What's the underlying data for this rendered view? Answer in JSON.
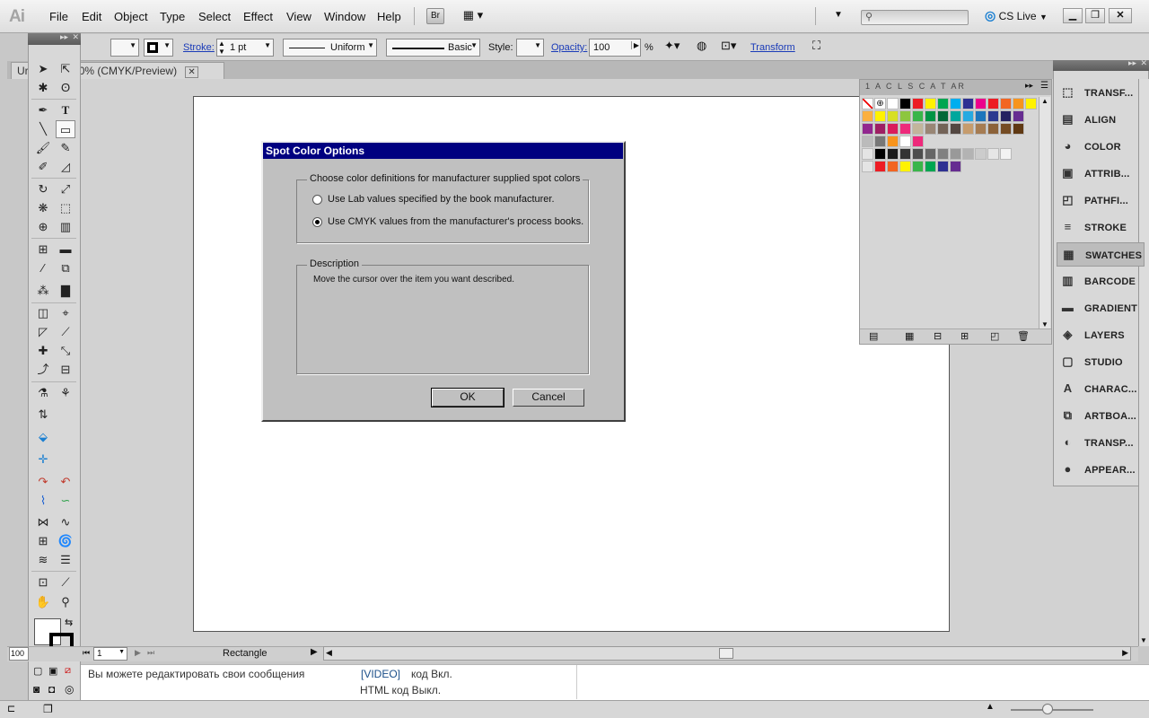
{
  "menubar": {
    "logo": "Ai",
    "items": [
      "File",
      "Edit",
      "Object",
      "Type",
      "Select",
      "Effect",
      "View",
      "Window",
      "Help"
    ],
    "bridge_label": "Br",
    "cslive_label": "CS Live"
  },
  "controlbar": {
    "stroke_label": "Stroke:",
    "stroke_value": "1 pt",
    "profile_label": "Uniform",
    "brush_label": "Basic",
    "style_label": "Style:",
    "opacity_label": "Opacity:",
    "opacity_value": "100",
    "percent": "%",
    "transform_label": "Transform"
  },
  "document": {
    "tab_label": "Ur... @ 100% (CMYK/Preview)",
    "tab_prefix": "Ur",
    "tab_suffix": "100% (CMYK/Preview)",
    "zoom": "100",
    "artboard_number": "1",
    "status_tool": "Rectangle"
  },
  "dialog": {
    "title": "Spot Color Options",
    "group1_legend": "Choose color definitions for manufacturer supplied spot colors",
    "option_lab": "Use Lab values specified by the book manufacturer.",
    "option_cmyk": "Use CMYK values from the manufacturer's process books.",
    "selected_option": "cmyk",
    "group2_legend": "Description",
    "description_text": "Move the cursor over the item you want described.",
    "ok_label": "OK",
    "cancel_label": "Cancel"
  },
  "right_dock": {
    "items": [
      {
        "label": "TRANSF...",
        "icon": "transform-icon"
      },
      {
        "label": "ALIGN",
        "icon": "align-icon"
      },
      {
        "label": "COLOR",
        "icon": "color-icon"
      },
      {
        "label": "ATTRIB...",
        "icon": "attributes-icon"
      },
      {
        "label": "PATHFI...",
        "icon": "pathfinder-icon"
      },
      {
        "label": "STROKE",
        "icon": "stroke-icon"
      },
      {
        "label": "SWATCHES",
        "icon": "swatches-icon"
      },
      {
        "label": "BARCODE",
        "icon": "barcode-icon"
      },
      {
        "label": "GRADIENT",
        "icon": "gradient-icon"
      },
      {
        "label": "LAYERS",
        "icon": "layers-icon"
      },
      {
        "label": "STUDIO",
        "icon": "studio-icon"
      },
      {
        "label": "CHARAC...",
        "icon": "character-icon"
      },
      {
        "label": "ARTBOA...",
        "icon": "artboards-icon"
      },
      {
        "label": "TRANSP...",
        "icon": "transparency-icon"
      },
      {
        "label": "APPEAR...",
        "icon": "appearance-icon"
      }
    ],
    "active": "SWATCHES"
  },
  "swatches_panel": {
    "tab_letters": "1 A C  L S C A T AR",
    "colors_row1": [
      "#ffffff",
      "#000000",
      "#ed1c24",
      "#fff200",
      "#00a651",
      "#00aeef",
      "#2e3192",
      "#ec008c",
      "#ed1c24",
      "#f26522",
      "#f7941d",
      "#fff200"
    ],
    "colors_row2": [
      "#fbb040",
      "#fff200",
      "#d7df23",
      "#8dc63f",
      "#39b54a",
      "#009444",
      "#006838",
      "#00a79d",
      "#27aae1",
      "#1c75bc",
      "#2b3990",
      "#262262",
      "#662d91"
    ],
    "colors_row3": [
      "#92278f",
      "#9e1f63",
      "#da1c5c",
      "#ee2a7b",
      "#c2b59b",
      "#998675",
      "#736357",
      "#534741",
      "#c69c6d",
      "#a67c52",
      "#8c6239",
      "#754c24",
      "#603913"
    ],
    "grays": [
      "#000000",
      "#1a1a1a",
      "#333333",
      "#4d4d4d",
      "#666666",
      "#808080",
      "#999999",
      "#b3b3b3",
      "#cccccc",
      "#e6e6e6",
      "#f2f2f2"
    ],
    "group_colors": [
      "#ed1c24",
      "#f26522",
      "#fff200",
      "#39b54a",
      "#00a651",
      "#2e3192",
      "#662d91"
    ]
  },
  "chat": {
    "message": "Вы можете редактировать свои сообщения",
    "video_tag": "[VIDEO]",
    "video_text": "код Вкл.",
    "html_text": "HTML код Выкл."
  }
}
